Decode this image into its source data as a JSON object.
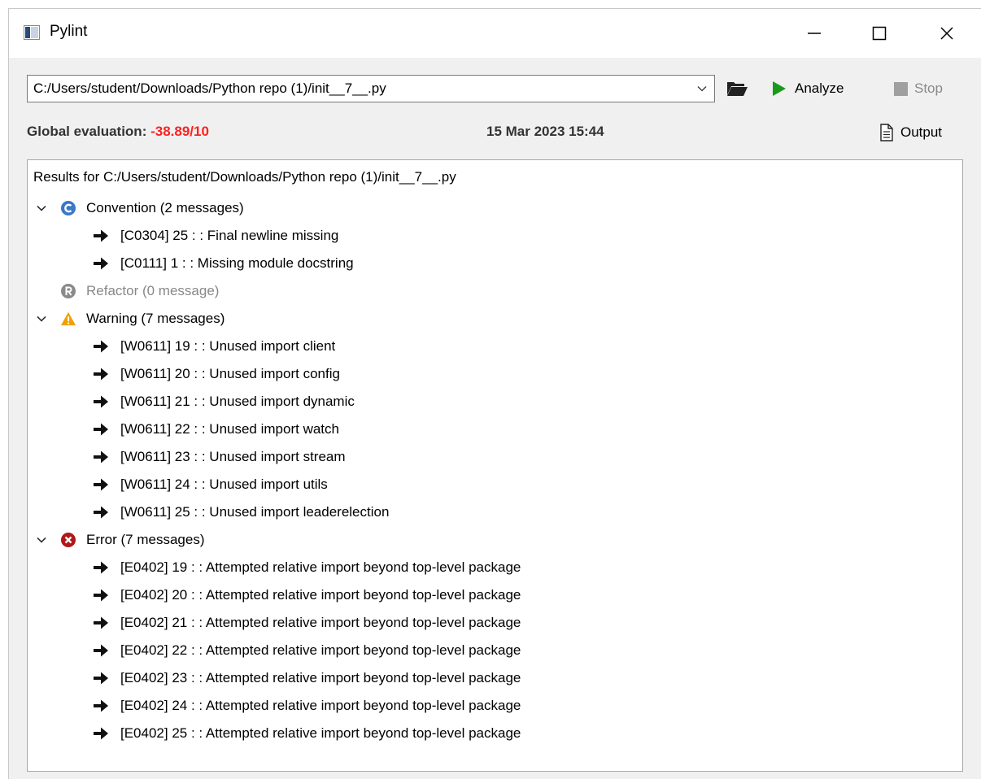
{
  "window": {
    "title": "Pylint",
    "controls": {
      "minimize": "minimize-icon",
      "maximize": "maximize-icon",
      "close": "close-icon"
    }
  },
  "toolbar": {
    "path_value": "C:/Users/student/Downloads/Python repo (1)/init__7__.py",
    "analyze_label": "Analyze",
    "stop_label": "Stop"
  },
  "evaluation": {
    "label": "Global evaluation:",
    "score": "-38.89/10",
    "date": "15 Mar 2023 15:44",
    "output_label": "Output"
  },
  "results": {
    "header": "Results for C:/Users/student/Downloads/Python repo (1)/init__7__.py",
    "categories": [
      {
        "label": "Convention (2 messages)",
        "icon": "convention-icon",
        "expanded": true,
        "messages": [
          "[C0304] 25 : : Final newline missing",
          "[C0111] 1 : : Missing module docstring"
        ]
      },
      {
        "label": "Refactor (0 message)",
        "icon": "refactor-icon",
        "expanded": false,
        "messages": []
      },
      {
        "label": "Warning (7 messages)",
        "icon": "warning-icon",
        "expanded": true,
        "messages": [
          "[W0611] 19 : : Unused import client",
          "[W0611] 20 : : Unused import config",
          "[W0611] 21 : : Unused import dynamic",
          "[W0611] 22 : : Unused import watch",
          "[W0611] 23 : : Unused import stream",
          "[W0611] 24 : : Unused import utils",
          "[W0611] 25 : : Unused import leaderelection"
        ]
      },
      {
        "label": "Error (7 messages)",
        "icon": "error-icon",
        "expanded": true,
        "messages": [
          "[E0402] 19 : : Attempted relative import beyond top-level package",
          "[E0402] 20 : : Attempted relative import beyond top-level package",
          "[E0402] 21 : : Attempted relative import beyond top-level package",
          "[E0402] 22 : : Attempted relative import beyond top-level package",
          "[E0402] 23 : : Attempted relative import beyond top-level package",
          "[E0402] 24 : : Attempted relative import beyond top-level package",
          "[E0402] 25 : : Attempted relative import beyond top-level package"
        ]
      }
    ]
  },
  "colors": {
    "score": "#ff2020",
    "analyze": "#1a9a1a",
    "convention": "#3a78c8",
    "refactor": "#8a8a8a",
    "warning": "#f0a000",
    "error": "#b01818"
  }
}
